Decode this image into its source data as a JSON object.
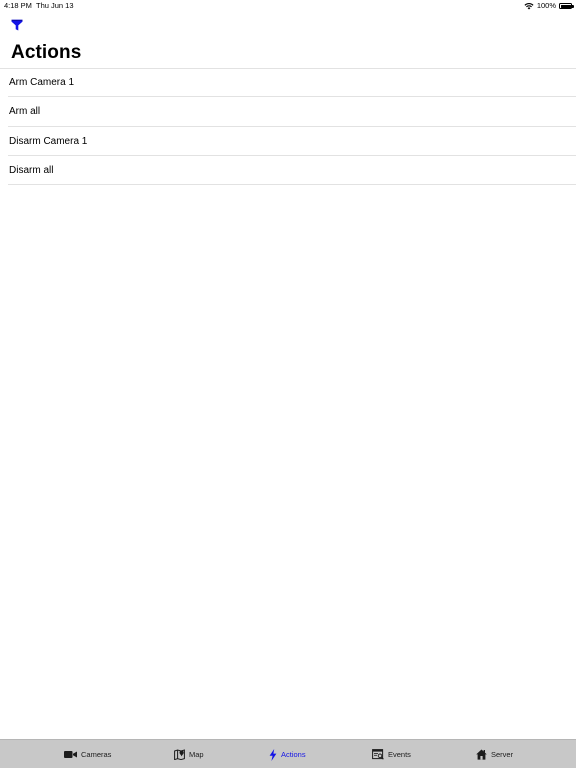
{
  "status_bar": {
    "time": "4:18 PM",
    "date": "Thu Jun 13",
    "battery": "100%"
  },
  "nav": {
    "filter_icon": "filter-icon",
    "title": "Actions"
  },
  "actions": [
    {
      "label": "Arm Camera 1"
    },
    {
      "label": "Arm all"
    },
    {
      "label": "Disarm Camera 1"
    },
    {
      "label": "Disarm all"
    }
  ],
  "tabs": [
    {
      "label": "Cameras",
      "icon": "video-camera-icon",
      "active": false
    },
    {
      "label": "Map",
      "icon": "map-icon",
      "active": false
    },
    {
      "label": "Actions",
      "icon": "lightning-icon",
      "active": true
    },
    {
      "label": "Events",
      "icon": "events-icon",
      "active": false
    },
    {
      "label": "Server",
      "icon": "house-icon",
      "active": false
    }
  ],
  "colors": {
    "accent": "#1414e6",
    "tab_bar_bg": "#c8c8c8",
    "separator": "#e2e2e2"
  }
}
